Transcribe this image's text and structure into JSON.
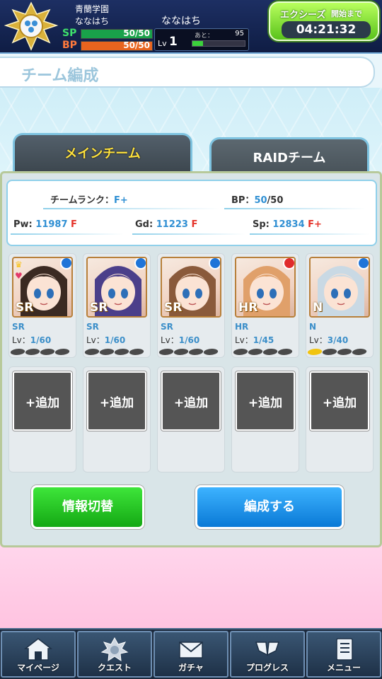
{
  "header": {
    "school": "青蘭学園",
    "player_name": "ななはち",
    "player_name_center": "ななはち",
    "sp": {
      "label": "SP",
      "value": "50/50",
      "fill": 1.0,
      "color": "#19a24a"
    },
    "bp": {
      "label": "BP",
      "value": "50/50",
      "fill": 1.0,
      "color": "#e8641e"
    },
    "level": {
      "label": "Lv",
      "value": "1",
      "exp_label": "あと：",
      "exp_value": "95",
      "exp_fill": 0.2
    },
    "event": {
      "label": "エクシーズ",
      "label_suffix": "開始まで",
      "countdown": "04:21:32"
    }
  },
  "title": "チーム編成",
  "tabs": [
    {
      "label": "メインチーム",
      "active": true
    },
    {
      "label": "RAIDチーム",
      "active": false
    }
  ],
  "team_info": {
    "rank_label": "チームランク：",
    "rank_value": "F+",
    "bp_label": "BP：",
    "bp_current": "50",
    "bp_max": "/50",
    "pw_label": "Pw:",
    "pw_value": "11987",
    "pw_rank": "F",
    "gd_label": "Gd:",
    "gd_value": "11223",
    "gd_rank": "F",
    "sp_label": "Sp:",
    "sp_value": "12834",
    "sp_rank": "F+"
  },
  "members": [
    {
      "rarity": "SR",
      "lv_label": "Lv：",
      "lv": "1/60",
      "orb": "blue",
      "leader": true,
      "pips_gold": 0,
      "hair": "#3b2a22"
    },
    {
      "rarity": "SR",
      "lv_label": "Lv：",
      "lv": "1/60",
      "orb": "blue",
      "leader": false,
      "pips_gold": 0,
      "hair": "#4b3f8a"
    },
    {
      "rarity": "SR",
      "lv_label": "Lv：",
      "lv": "1/60",
      "orb": "blue",
      "leader": false,
      "pips_gold": 0,
      "hair": "#8a5a3b"
    },
    {
      "rarity": "HR",
      "lv_label": "Lv：",
      "lv": "1/45",
      "orb": "red",
      "leader": false,
      "pips_gold": 0,
      "hair": "#e0a06a"
    },
    {
      "rarity": "N",
      "lv_label": "Lv：",
      "lv": "3/40",
      "orb": "blue",
      "leader": false,
      "pips_gold": 1,
      "hair": "#c9d9e4"
    }
  ],
  "slots": [
    {
      "label": "+追加"
    },
    {
      "label": "+追加"
    },
    {
      "label": "+追加"
    },
    {
      "label": "+追加"
    },
    {
      "label": "+追加"
    }
  ],
  "buttons": {
    "info_toggle": "情報切替",
    "organize": "編成する"
  },
  "nav": [
    {
      "label": "マイページ",
      "icon": "house-icon"
    },
    {
      "label": "クエスト",
      "icon": "quest-emblem-icon"
    },
    {
      "label": "ガチャ",
      "icon": "envelope-icon"
    },
    {
      "label": "プログレス",
      "icon": "progress-icon"
    },
    {
      "label": "メニュー",
      "icon": "menu-book-icon"
    }
  ]
}
